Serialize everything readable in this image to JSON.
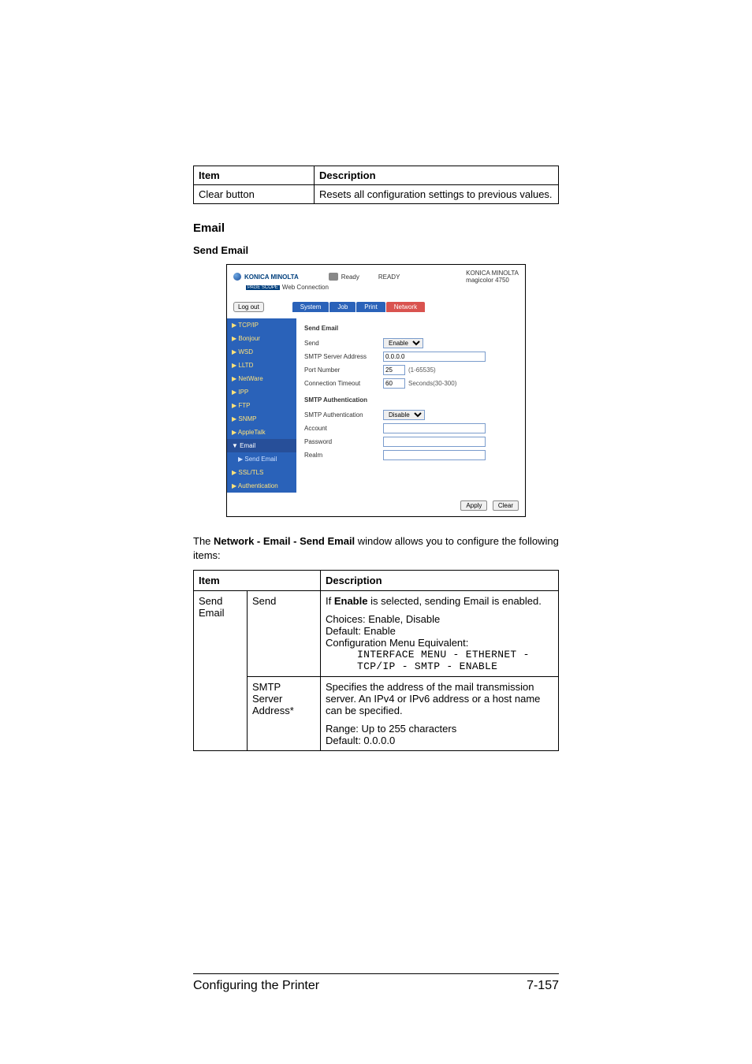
{
  "topTable": {
    "headItem": "Item",
    "headDesc": "Description",
    "rowItem": "Clear button",
    "rowDesc": "Resets all configuration settings to previous values."
  },
  "sectionTitle": "Email",
  "subsectionTitle": "Send Email",
  "shot": {
    "brand": "KONICA MINOLTA",
    "webConn": "Web Connection",
    "pageScope": "PAGE SCOPE",
    "readyIcon": "Ready",
    "readyText": "READY",
    "brandRight1": "KONICA MINOLTA",
    "brandRight2": "magicolor 4750",
    "logout": "Log out",
    "tabs": {
      "system": "System",
      "job": "Job",
      "print": "Print",
      "network": "Network"
    },
    "sidebar": {
      "tcpip": "▶ TCP/IP",
      "bonjour": "▶ Bonjour",
      "wsd": "▶ WSD",
      "lltd": "▶ LLTD",
      "netware": "▶ NetWare",
      "ipp": "▶ IPP",
      "ftp": "▶ FTP",
      "snmp": "▶ SNMP",
      "appletalk": "▶ AppleTalk",
      "email": "▼ Email",
      "sendEmail": "▶ Send Email",
      "ssltls": "▶ SSL/TLS",
      "auth": "▶ Authentication"
    },
    "content": {
      "title1": "Send Email",
      "sendLabel": "Send",
      "sendValue": "Enable",
      "smtpAddrLabel": "SMTP Server Address",
      "smtpAddrValue": "0.0.0.0",
      "portLabel": "Port Number",
      "portValue": "25",
      "portHint": "(1-65535)",
      "timeoutLabel": "Connection Timeout",
      "timeoutValue": "60",
      "timeoutHint": "Seconds(30-300)",
      "title2": "SMTP Authentication",
      "smtpAuthLabel": "SMTP Authentication",
      "smtpAuthValue": "Disable",
      "accountLabel": "Account",
      "passwordLabel": "Password",
      "realmLabel": "Realm"
    },
    "apply": "Apply",
    "clear": "Clear"
  },
  "bodyPara": {
    "pre": "The ",
    "bold": "Network - Email - Send Email",
    "post": " window allows you to configure the following items:"
  },
  "descTable": {
    "headItem": "Item",
    "headDesc": "Description",
    "row1c1": "Send Email",
    "row1c2": "Send",
    "row1d_line1a": "If ",
    "row1d_line1b": "Enable",
    "row1d_line1c": " is selected, sending Email is enabled.",
    "row1d_choices": "Choices: Enable, Disable",
    "row1d_default": "Default:  Enable",
    "row1d_cfg": "Configuration Menu Equivalent:",
    "row1d_mono1": "INTERFACE MENU - ETHERNET -",
    "row1d_mono2": "TCP/IP - SMTP - ENABLE",
    "row2c2a": "SMTP",
    "row2c2b": "Server",
    "row2c2c": "Address*",
    "row2d_line1": "Specifies the address of the mail transmission server. An IPv4 or IPv6 address or a host name can be specified.",
    "row2d_range": "Range:   Up to 255 characters",
    "row2d_default": "Default:  0.0.0.0"
  },
  "footer": {
    "left": "Configuring the Printer",
    "right": "7-157"
  }
}
